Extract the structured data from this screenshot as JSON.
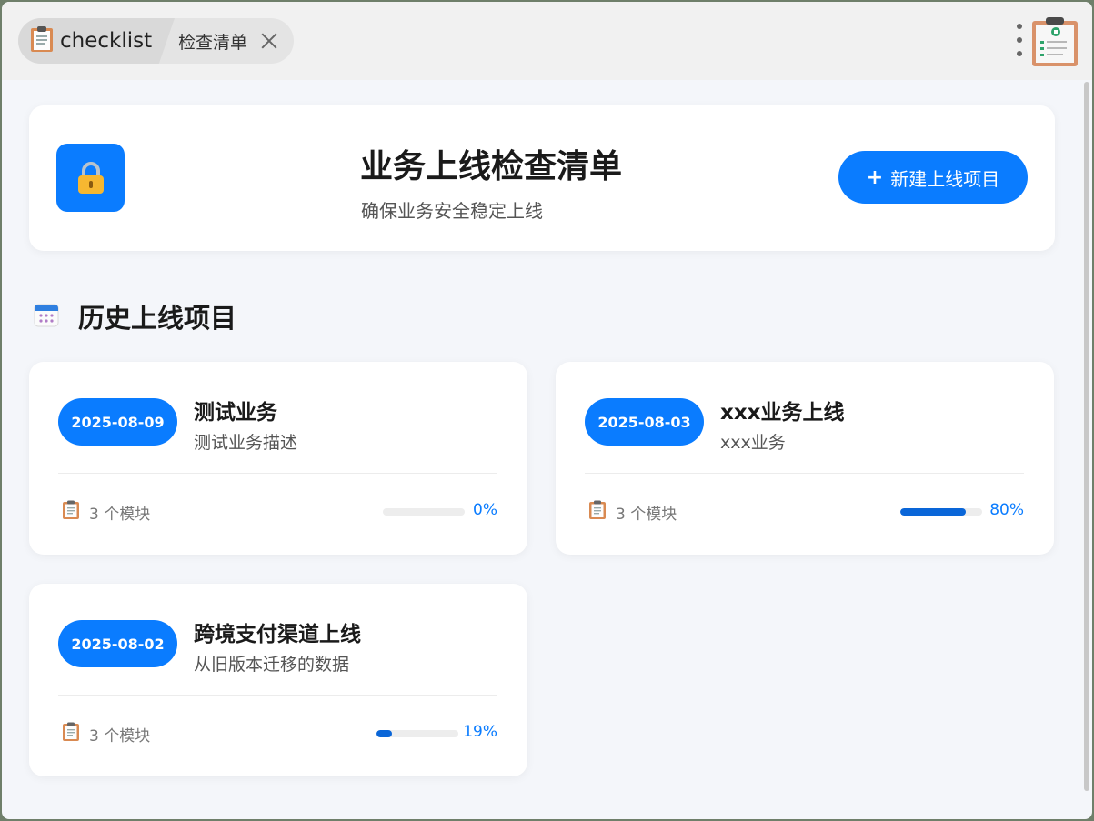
{
  "titlebar": {
    "app_name": "checklist",
    "tab_label": "检查清单",
    "icons": {
      "app": "clipboard-icon",
      "close": "close-icon",
      "menu": "more-vertical-icon",
      "logo": "clipboard-logo"
    }
  },
  "header": {
    "title": "业务上线检查清单",
    "subtitle": "确保业务安全稳定上线",
    "new_button_plus": "+",
    "new_button_label": "新建上线项目",
    "icon": "lock-icon"
  },
  "section": {
    "title": "历史上线项目",
    "icon": "calendar-icon"
  },
  "projects": [
    {
      "date": "2025-08-09",
      "title": "测试业务",
      "desc": "测试业务描述",
      "modules": "3 个模块",
      "progress": 0,
      "progress_label": "0%"
    },
    {
      "date": "2025-08-03",
      "title": "xxx业务上线",
      "desc": "xxx业务",
      "modules": "3 个模块",
      "progress": 80,
      "progress_label": "80%"
    },
    {
      "date": "2025-08-02",
      "title": "跨境支付渠道上线",
      "desc": "从旧版本迁移的数据",
      "modules": "3 个模块",
      "progress": 19,
      "progress_label": "19%"
    }
  ],
  "colors": {
    "accent": "#0a7cff",
    "progress": "#0a66d8",
    "background": "#f4f6fa"
  }
}
